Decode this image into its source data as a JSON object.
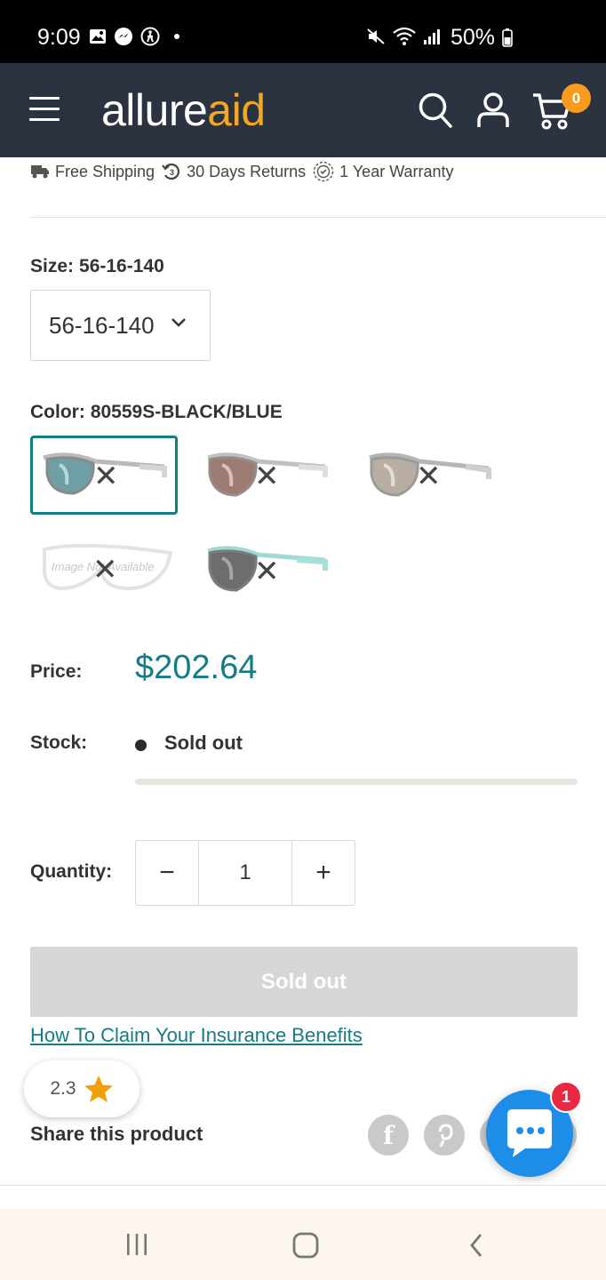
{
  "status_bar": {
    "time": "9:09",
    "battery": "50%"
  },
  "header": {
    "logo_part1": "allure",
    "logo_part2": "aid",
    "cart_count": "0"
  },
  "benefits": [
    {
      "label": "Free Shipping",
      "icon": "truck-icon"
    },
    {
      "label": "30 Days Returns",
      "icon": "return-icon"
    },
    {
      "label": "1 Year Warranty",
      "icon": "warranty-icon"
    }
  ],
  "size": {
    "label": "Size:",
    "value": "56-16-140",
    "selected": "56-16-140"
  },
  "color": {
    "label": "Color:",
    "value": "80559S-BLACK/BLUE"
  },
  "swatches": [
    {
      "name": "black-blue",
      "selected": true
    },
    {
      "name": "brown",
      "selected": false
    },
    {
      "name": "grey",
      "selected": false
    },
    {
      "name": "image-not-available",
      "selected": false,
      "text": "Image Not Available"
    },
    {
      "name": "black-tiffany",
      "selected": false
    }
  ],
  "price": {
    "label": "Price:",
    "value": "$202.64"
  },
  "stock": {
    "label": "Stock:",
    "value": "Sold out"
  },
  "quantity": {
    "label": "Quantity:",
    "value": "1",
    "minus": "−",
    "plus": "+"
  },
  "buttons": {
    "sold_out": "Sold out"
  },
  "insurance_link": "How To Claim Your Insurance Benefits",
  "rating": {
    "value": "2.3"
  },
  "share": {
    "label": "Share this product"
  },
  "chat": {
    "badge": "1"
  },
  "colors": {
    "accent": "#137c86",
    "header_bg": "#2b3240",
    "logo_orange": "#f5a623",
    "chat_blue": "#1d8de8"
  }
}
